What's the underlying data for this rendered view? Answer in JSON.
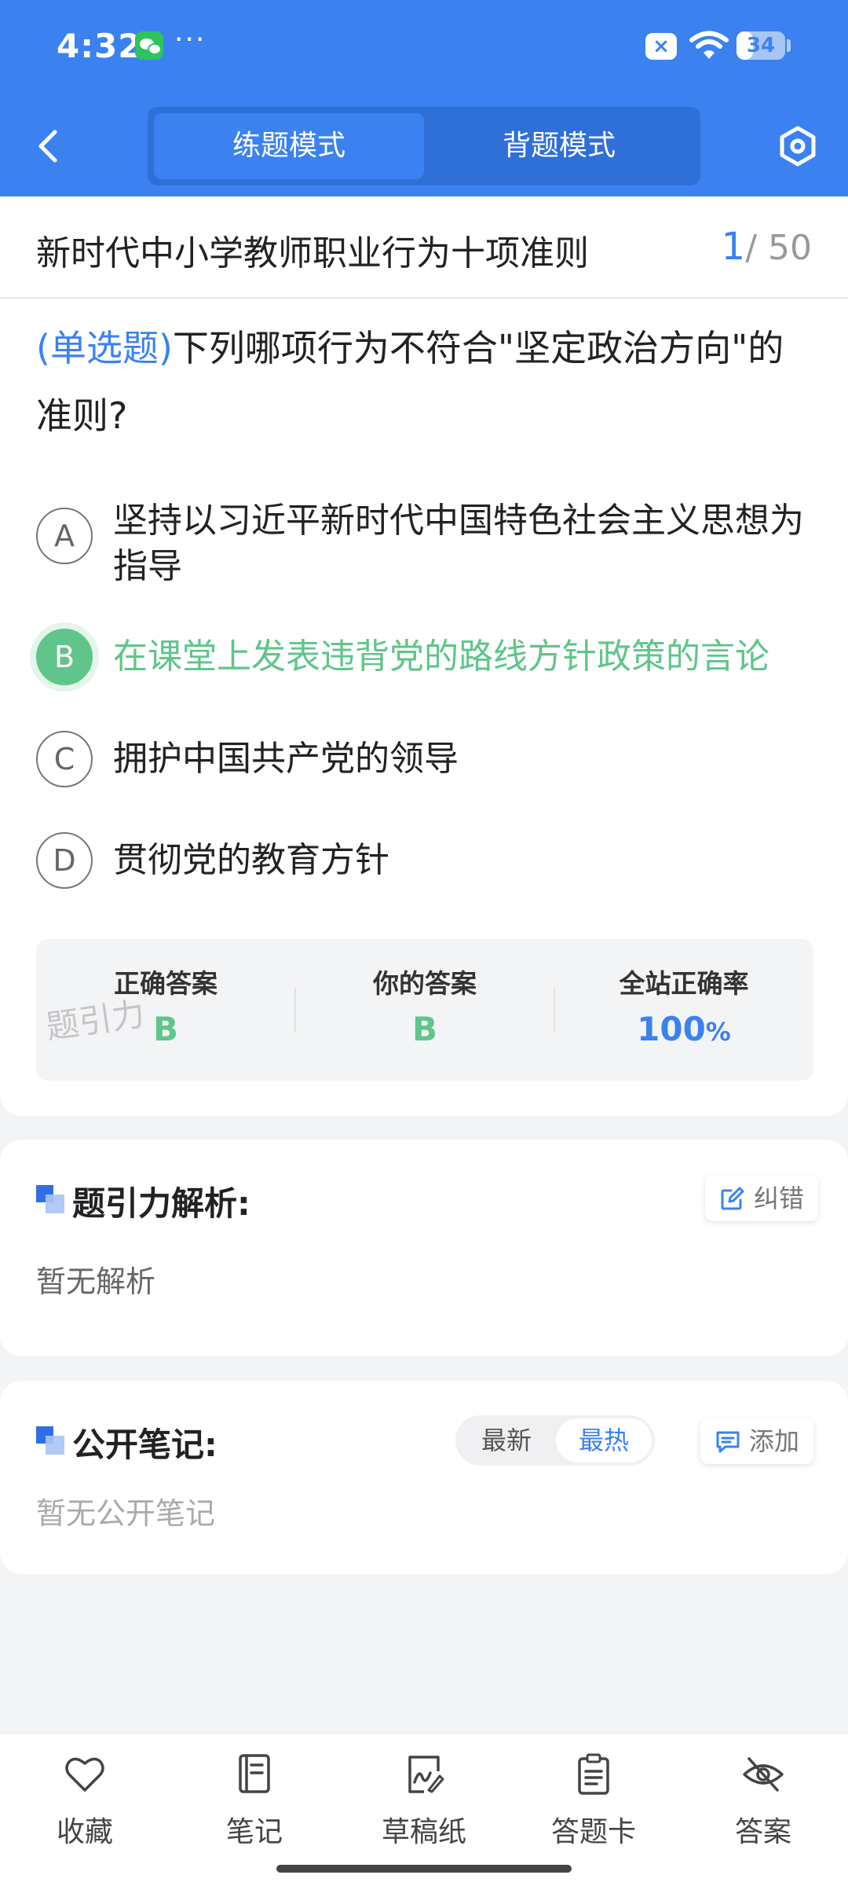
{
  "status_bar": {
    "time": "4:32",
    "more_dots": "···",
    "battery_level": "34",
    "battery_fraction": 0.34
  },
  "header": {
    "tabs": [
      {
        "label": "练题模式",
        "active": true
      },
      {
        "label": "背题模式",
        "active": false
      }
    ],
    "accent_color": "#3b82f0"
  },
  "question": {
    "chapter_title": "新时代中小学教师职业行为十项准则",
    "current_index": "1",
    "total": "/ 50",
    "type_label": "(单选题)",
    "text": "下列哪项行为不符合\"坚定政治方向\"的准则?",
    "options": [
      {
        "letter": "A",
        "text": "坚持以习近平新时代中国特色社会主义思想为指导",
        "correct": false
      },
      {
        "letter": "B",
        "text": "在课堂上发表违背党的路线方针政策的言论",
        "correct": true
      },
      {
        "letter": "C",
        "text": "拥护中国共产党的领导",
        "correct": false
      },
      {
        "letter": "D",
        "text": "贯彻党的教育方针",
        "correct": false
      }
    ]
  },
  "answer_summary": {
    "correct_label": "正确答案",
    "correct_value": "B",
    "yours_label": "你的答案",
    "yours_value": "B",
    "rate_label": "全站正确率",
    "rate_value": "100",
    "rate_unit": "%",
    "watermark": "题引力"
  },
  "analysis": {
    "title": "题引力解析:",
    "report_label": "纠错",
    "body": "暂无解析"
  },
  "notes": {
    "title": "公开笔记:",
    "sort_latest": "最新",
    "sort_hot": "最热",
    "add_label": "添加",
    "body": "暂无公开笔记"
  },
  "bottom_bar": [
    {
      "label": "收藏",
      "icon": "heart-icon"
    },
    {
      "label": "笔记",
      "icon": "notebook-icon"
    },
    {
      "label": "草稿纸",
      "icon": "draft-icon"
    },
    {
      "label": "答题卡",
      "icon": "answer-card-icon"
    },
    {
      "label": "答案",
      "icon": "eye-off-icon"
    }
  ],
  "colors": {
    "correct_green": "#5fc58a",
    "primary_blue": "#3b82f0"
  }
}
